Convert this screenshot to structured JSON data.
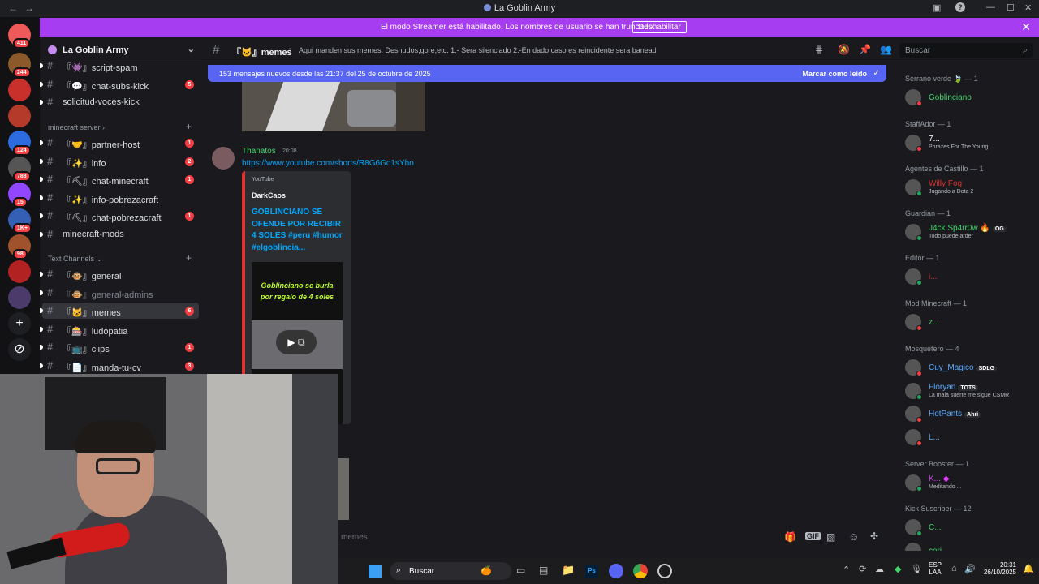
{
  "window": {
    "title": "La Goblin Army",
    "back": "←",
    "forward": "→"
  },
  "banner": {
    "text": "El modo Streamer está habilitado. Los nombres de usuario se han truncado.",
    "button": "Deshabilitar"
  },
  "servers": [
    {
      "badge": "411"
    },
    {
      "badge": "244"
    },
    {
      "badge": ""
    },
    {
      "badge": ""
    },
    {
      "badge": "124"
    },
    {
      "badge": "788"
    },
    {
      "badge": "15"
    },
    {
      "badge": "1K+"
    },
    {
      "badge": "98"
    },
    {
      "badge": ""
    },
    {
      "badge": ""
    }
  ],
  "guild": {
    "name": "La Goblin Army"
  },
  "channels_top": [
    {
      "label": "『👾』script-spam",
      "count": ""
    },
    {
      "label": "『💬』chat-subs-kick",
      "count": "5"
    },
    {
      "label": "solicitud-voces-kick",
      "count": ""
    }
  ],
  "cat_minecraft": "minecraft server",
  "channels_mc": [
    {
      "label": "『🤝』partner-host",
      "count": "1"
    },
    {
      "label": "『✨』info",
      "count": "2"
    },
    {
      "label": "『⛏』chat-minecraft",
      "count": "1"
    },
    {
      "label": "『✨』info-pobrezacraft",
      "count": ""
    },
    {
      "label": "『⛏』chat-pobrezacraft",
      "count": "1"
    },
    {
      "label": "minecraft-mods",
      "count": ""
    }
  ],
  "cat_text": "Text Channels",
  "channels_text": [
    {
      "label": "『🐵』general",
      "count": ""
    },
    {
      "label": "『🐵』general-admins",
      "count": ""
    },
    {
      "label": "『🐱』memes",
      "count": "6"
    },
    {
      "label": "『🎰』ludopatia",
      "count": ""
    },
    {
      "label": "『📺』clips",
      "count": "1"
    },
    {
      "label": "『📄』manda-tu-cv",
      "count": "3"
    }
  ],
  "header": {
    "channel": "『🐱』memes",
    "topic": "Aqui manden sus memes. Desnudos,gore,etc. 1.- Sera silenciado 2.-En dado caso es reincidente sera baneado",
    "search": "Buscar"
  },
  "newbar": {
    "text": "153 mensajes nuevos desde las 21:37 del 25 de octubre de 2025",
    "action": "Marcar como leído"
  },
  "message": {
    "author": "Thanatos",
    "time": "20:08",
    "link": "https://www.youtube.com/shorts/R8G6Go1sYho"
  },
  "embed": {
    "provider": "YouTube",
    "author": "DarkCaos",
    "title": "GOBLINCIANO SE OFENDE POR RECIBIR 4 SOLES #peru #humor #elgoblincia...",
    "thumb_text": "Goblinciano se burla por regalo de 4 soles"
  },
  "composer": {
    "placeholder": "memes"
  },
  "members": [
    {
      "type": "role",
      "text": "Serrano verde 🍃 — 1"
    },
    {
      "type": "member",
      "name": "Goblinciano",
      "sub": "",
      "tag": "",
      "color": "#43d36b",
      "status": "#f23f43"
    },
    {
      "type": "role",
      "text": "StaffAdor — 1"
    },
    {
      "type": "member",
      "name": "7...",
      "sub": "Phrazes For The Young",
      "tag": "",
      "color": "#ffffff",
      "status": "#f23f43"
    },
    {
      "type": "role",
      "text": "Agentes de Castillo — 1"
    },
    {
      "type": "member",
      "name": "Willy Fog",
      "sub": "Jugando a Dota 2",
      "tag": "",
      "color": "#e0302f",
      "status": "#23a55a"
    },
    {
      "type": "role",
      "text": "Guardian — 1"
    },
    {
      "type": "member",
      "name": "J4ck Sp4rr0w 🔥",
      "sub": "Todo puede arder",
      "tag": "OG",
      "color": "#43d36b",
      "status": "#23a55a"
    },
    {
      "type": "role",
      "text": "Editor — 1"
    },
    {
      "type": "member",
      "name": "i...",
      "sub": "",
      "tag": "",
      "color": "#e0302f",
      "status": "#23a55a"
    },
    {
      "type": "role",
      "text": "Mod Minecraft — 1"
    },
    {
      "type": "member",
      "name": "z...",
      "sub": "",
      "tag": "",
      "color": "#43d36b",
      "status": "#f23f43"
    },
    {
      "type": "role",
      "text": "Mosquetero — 4"
    },
    {
      "type": "member",
      "name": "Cuy_Magico",
      "sub": "",
      "tag": "SDLG",
      "color": "#5aa9ff",
      "status": "#f23f43"
    },
    {
      "type": "member",
      "name": "Floryan",
      "sub": "La mala suerte me sigue CSMR",
      "tag": "TOTS",
      "color": "#5aa9ff",
      "status": "#23a55a"
    },
    {
      "type": "member",
      "name": "HotPants",
      "sub": "",
      "tag": "Ahri",
      "color": "#5aa9ff",
      "status": "#f23f43"
    },
    {
      "type": "member",
      "name": "L...",
      "sub": "",
      "tag": "",
      "color": "#5aa9ff",
      "status": "#f23f43"
    },
    {
      "type": "role",
      "text": "Server Booster — 1"
    },
    {
      "type": "member",
      "name": "K... ◆",
      "sub": "Meditando ...",
      "tag": "",
      "color": "#e040fb",
      "status": "#23a55a"
    },
    {
      "type": "role",
      "text": "Kick Suscriber — 12"
    },
    {
      "type": "member",
      "name": "C...",
      "sub": "",
      "tag": "",
      "color": "#43d36b",
      "status": "#23a55a"
    },
    {
      "type": "member",
      "name": "cori",
      "sub": "",
      "tag": "",
      "color": "#43d36b",
      "status": "#23a55a"
    }
  ],
  "taskbar": {
    "search": "Buscar",
    "lang": "ESP",
    "lang2": "LAA",
    "time": "20:31",
    "date": "26/10/2025"
  }
}
